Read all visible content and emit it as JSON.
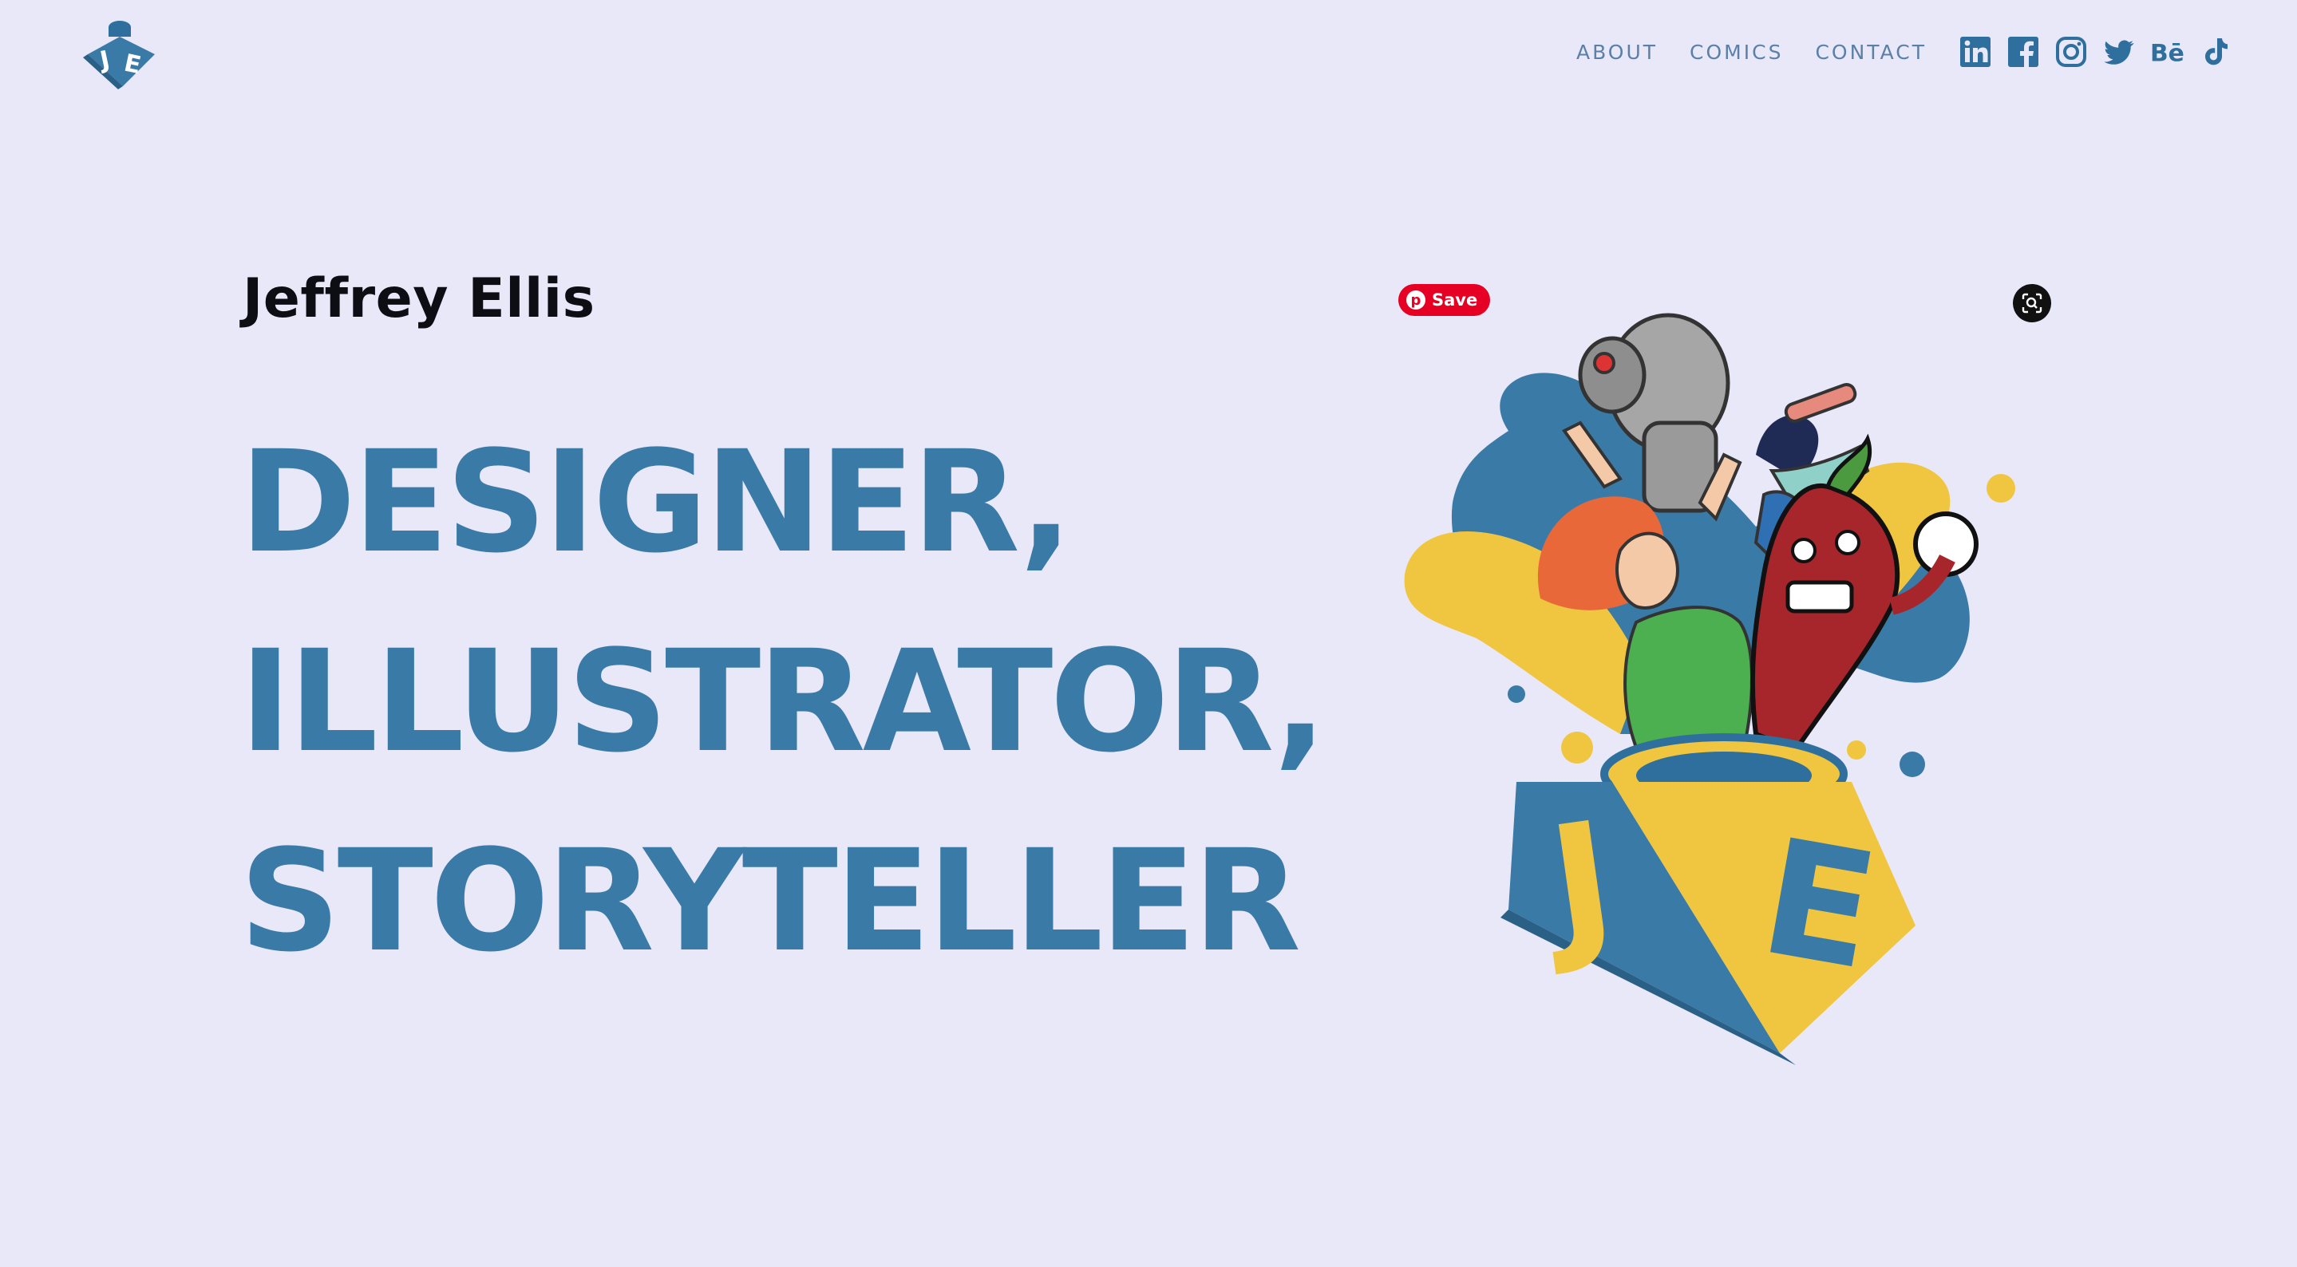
{
  "header": {
    "logo_alt": "JE",
    "nav": [
      {
        "label": "ABOUT"
      },
      {
        "label": "COMICS"
      },
      {
        "label": "CONTACT"
      }
    ],
    "social_icons": [
      "linkedin-icon",
      "facebook-icon",
      "instagram-icon",
      "twitter-icon",
      "behance-icon",
      "tiktok-icon"
    ],
    "nav_color": "#5b80a8"
  },
  "hero": {
    "name": "Jeffrey Ellis",
    "headline": [
      "DESIGNER,",
      "ILLUSTRATOR,",
      "STORYTELLER"
    ],
    "headline_color": "#3a7aa6"
  },
  "overlay": {
    "pinterest_save": "Save"
  },
  "illustration": {
    "box_letters": "JE"
  },
  "colors": {
    "background": "#e8e8f9",
    "blue": "#3a7aa6",
    "yellow": "#f0c53f",
    "pinterest_red": "#e60023"
  }
}
